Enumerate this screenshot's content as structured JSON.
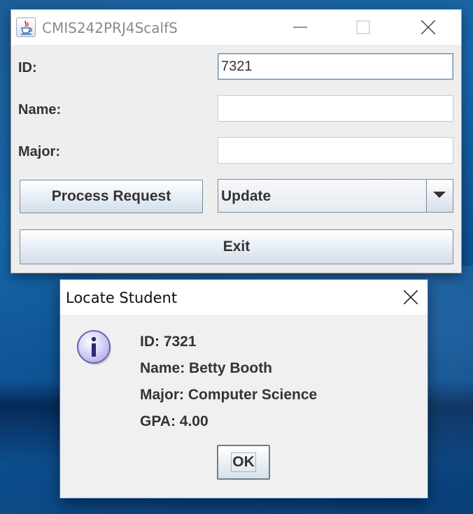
{
  "main_window": {
    "title": "CMIS242PRJ4ScalfS",
    "icon": "java-cup-icon",
    "fields": {
      "id_label": "ID:",
      "id_value": "7321",
      "name_label": "Name:",
      "name_value": "",
      "major_label": "Major:",
      "major_value": ""
    },
    "process_button": "Process Request",
    "request_combo": {
      "selected": "Update"
    },
    "exit_button": "Exit"
  },
  "dialog": {
    "title": "Locate Student",
    "icon": "info-icon",
    "lines": {
      "id": "ID: 7321",
      "name": "Name: Betty Booth",
      "major": "Major: Computer Science",
      "gpa": "GPA: 4.00"
    },
    "ok_button": "OK"
  },
  "colors": {
    "desktop": "#1766a8",
    "window_bg": "#eeeeee",
    "field_border": "#b8cfe5",
    "button_border": "#7a8a99",
    "info_icon_fill": "#c9c6f2"
  }
}
